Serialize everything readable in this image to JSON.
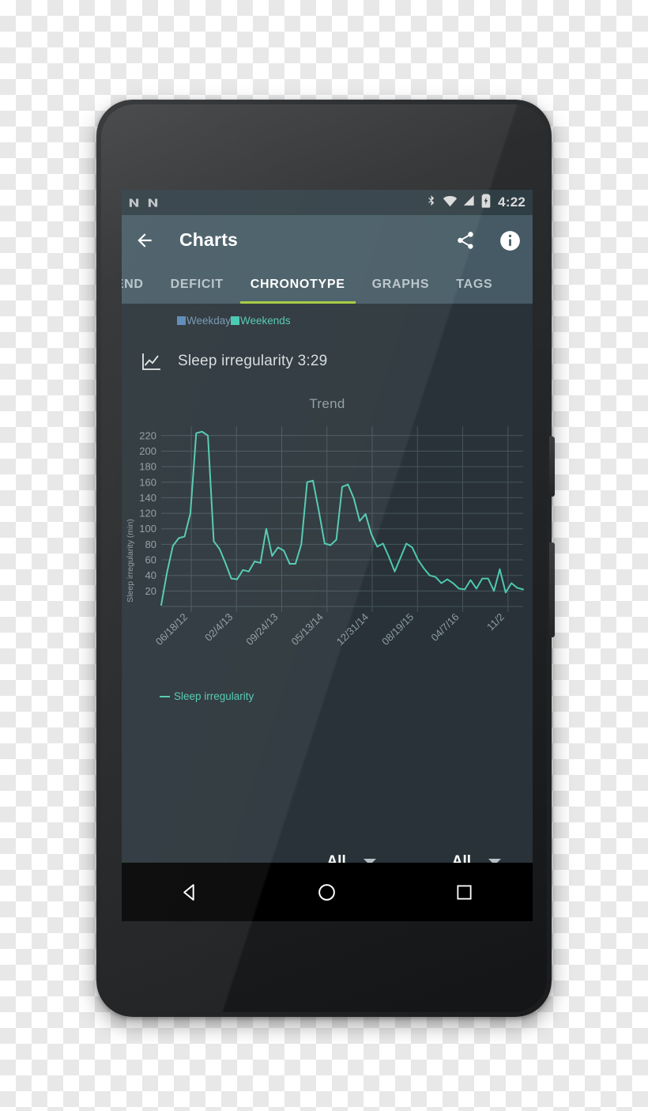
{
  "status_bar": {
    "notification_icons": [
      "n-notification-icon",
      "n-notification-icon"
    ],
    "bluetooth_icon": "bluetooth-icon",
    "wifi_icon": "wifi-icon",
    "signal_icon": "cellular-signal-icon",
    "battery_icon": "battery-charging-icon",
    "time": "4:22"
  },
  "app_bar": {
    "back_icon": "back-arrow-icon",
    "title": "Charts",
    "share_icon": "share-icon",
    "info_icon": "info-icon"
  },
  "tabs": [
    {
      "label": "TREND",
      "active": false
    },
    {
      "label": "DEFICIT",
      "active": false
    },
    {
      "label": "CHRONOTYPE",
      "active": true
    },
    {
      "label": "GRAPHS",
      "active": false
    },
    {
      "label": "TAGS",
      "active": false
    }
  ],
  "tab_indicator_color": "#a4c93a",
  "legend": [
    {
      "label": "Weekday",
      "color": "#5a87b5"
    },
    {
      "label": "Weekends",
      "color": "#3fc8ae"
    }
  ],
  "summary": {
    "icon": "line-chart-icon",
    "text": "Sleep irregularity 3:29"
  },
  "selects": [
    {
      "value": "All",
      "caret": "chevron-down-icon"
    },
    {
      "value": "All",
      "caret": "chevron-down-icon"
    }
  ],
  "series_legend": {
    "label": "Sleep irregularity",
    "color": "#4fc8b0"
  },
  "nav_bar": {
    "back": "nav-back-triangle-icon",
    "home": "nav-home-circle-icon",
    "recents": "nav-recents-square-icon"
  },
  "chart_data": {
    "type": "line",
    "title": "Trend",
    "xlabel": "",
    "ylabel": "Sleep irregularity (min)",
    "ylim": [
      0,
      232
    ],
    "yticks": [
      20,
      40,
      60,
      80,
      100,
      120,
      140,
      160,
      180,
      200,
      220
    ],
    "grid": true,
    "legend_position": "bottom-left",
    "line_color": "#4fc8b0",
    "background": "#283238",
    "gridline_color": "#46555d",
    "xtick_labels": [
      "06/18/12",
      "02/4/13",
      "09/24/13",
      "05/13/14",
      "12/31/14",
      "08/19/15",
      "04/7/16",
      "11/2"
    ],
    "xtick_positions": [
      0.083,
      0.208,
      0.333,
      0.458,
      0.583,
      0.708,
      0.833,
      0.958
    ],
    "series": [
      {
        "name": "Sleep irregularity",
        "values": [
          2,
          44,
          78,
          88,
          90,
          120,
          223,
          225,
          220,
          84,
          74,
          56,
          36,
          35,
          47,
          45,
          58,
          56,
          100,
          65,
          76,
          72,
          55,
          55,
          80,
          160,
          162,
          123,
          81,
          79,
          86,
          154,
          157,
          139,
          110,
          119,
          93,
          77,
          81,
          64,
          45,
          63,
          81,
          76,
          60,
          49,
          40,
          38,
          30,
          35,
          30,
          23,
          22,
          34,
          23,
          36,
          36,
          20,
          48,
          18,
          30,
          24,
          22
        ]
      }
    ]
  }
}
